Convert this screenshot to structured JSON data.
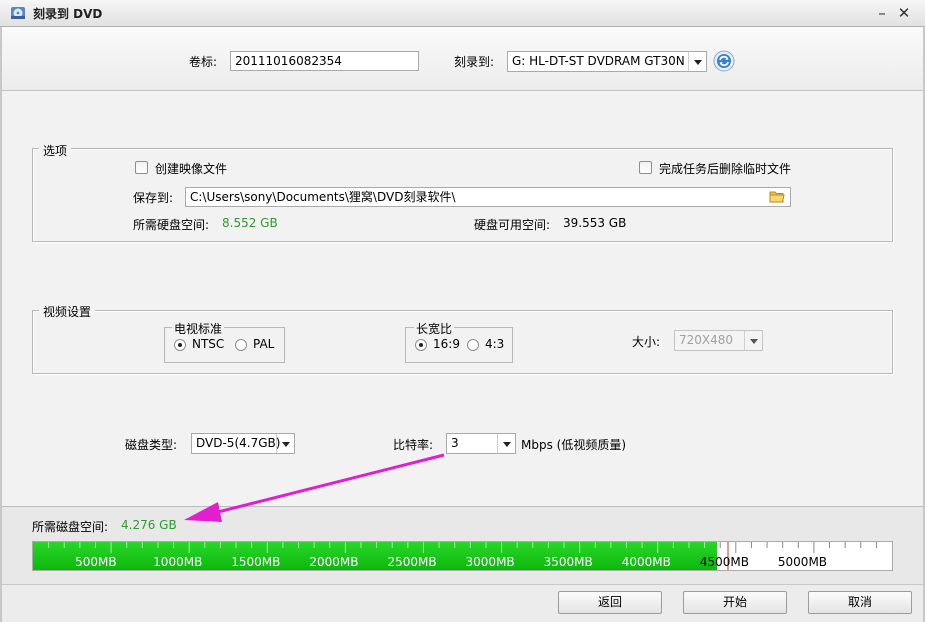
{
  "window": {
    "title": "刻录到 DVD",
    "minimize_glyph": "–",
    "close_glyph": "✕"
  },
  "top": {
    "volume_label": "卷标:",
    "volume_value": "20111016082354",
    "burn_to_label": "刻录到:",
    "drive_value": "G: HL-DT-ST DVDRAM GT30N",
    "refresh_icon": "refresh-icon"
  },
  "options": {
    "title": "选项",
    "create_image_label": "创建映像文件",
    "delete_temp_label": "完成任务后删除临时文件",
    "save_to_label": "保存到:",
    "save_path": "C:\\Users\\sony\\Documents\\狸窝\\DVD刻录软件\\",
    "required_space_label": "所需硬盘空间:",
    "required_space_value": "8.552 GB",
    "available_space_label": "硬盘可用空间:",
    "available_space_value": "39.553 GB"
  },
  "video": {
    "title": "视频设置",
    "tv_standard_title": "电视标准",
    "ntsc_label": "NTSC",
    "pal_label": "PAL",
    "aspect_title": "长宽比",
    "aspect_169_label": "16:9",
    "aspect_43_label": "4:3",
    "size_label": "大小:",
    "size_value": "720X480"
  },
  "disc": {
    "disc_type_label": "磁盘类型:",
    "disc_type_value": "DVD-5(4.7GB)",
    "bitrate_label": "比特率:",
    "bitrate_value": "3",
    "bitrate_unit": "Mbps (低视频质量)"
  },
  "usage": {
    "required_label": "所需磁盘空间:",
    "required_value": "4.276 GB",
    "capacity_mb": 5500,
    "used_mb": 4379,
    "marker_mb": 4450,
    "ticks": [
      "500MB",
      "1000MB",
      "1500MB",
      "2000MB",
      "2500MB",
      "3000MB",
      "3500MB",
      "4000MB",
      "4500MB",
      "5000MB"
    ],
    "fill_color": "#0cb80c",
    "marker_color": "#d03030"
  },
  "annotation": {
    "arrow_color": "#e020d0"
  },
  "footer": {
    "back_label": "返回",
    "start_label": "开始",
    "cancel_label": "取消"
  }
}
